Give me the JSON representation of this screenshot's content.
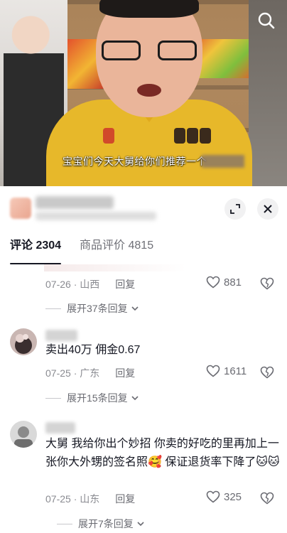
{
  "video": {
    "subtitle": "宝宝们今天大舅给你们推荐一个"
  },
  "tabs": [
    {
      "label": "评论 2304",
      "active": true
    },
    {
      "label": "商品评价 4815",
      "active": false
    }
  ],
  "comments": [
    {
      "text": "",
      "date": "07-26",
      "location": "山西",
      "reply_label": "回复",
      "likes": "881",
      "expand_label": "展开37条回复"
    },
    {
      "text": "卖出40万 佣金0.67",
      "date": "07-25",
      "location": "广东",
      "reply_label": "回复",
      "likes": "1611",
      "expand_label": "展开15条回复"
    },
    {
      "text": "大舅 我给你出个妙招 你卖的好吃的里再加上一张你大外甥的签名照🥰 保证退货率下降了🐱🐱",
      "date": "07-25",
      "location": "山东",
      "reply_label": "回复",
      "likes": "325",
      "expand_label": "展开7条回复"
    }
  ],
  "meta_separator": " · ",
  "colors": {
    "shirt": "#e7b82a",
    "text_primary": "#161823",
    "text_secondary": "#8a8b91"
  },
  "icons": [
    "search-icon",
    "expand-icon",
    "close-icon",
    "heart-icon",
    "dislike-heart-icon",
    "chevron-down-icon"
  ]
}
